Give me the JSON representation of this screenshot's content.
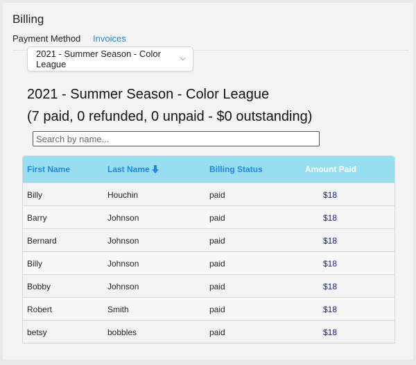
{
  "page": {
    "title": "Billing"
  },
  "tabs": [
    {
      "label": "Payment Method",
      "active": false
    },
    {
      "label": "Invoices",
      "active": true
    }
  ],
  "season_select": {
    "value": "2021 - Summer Season - Color League"
  },
  "heading": {
    "season": "2021 - Summer Season - Color League",
    "summary": "(7 paid, 0 refunded, 0 unpaid - $0 outstanding)"
  },
  "search": {
    "placeholder": "Search by name...",
    "value": ""
  },
  "table": {
    "columns": [
      "First Name",
      "Last Name",
      "Billing Status",
      "Amount Paid"
    ],
    "sorted_by": "Last Name",
    "rows": [
      {
        "first": "Billy",
        "last": "Houchin",
        "status": "paid",
        "amount": "$18"
      },
      {
        "first": "Barry",
        "last": "Johnson",
        "status": "paid",
        "amount": "$18"
      },
      {
        "first": "Bernard",
        "last": "Johnson",
        "status": "paid",
        "amount": "$18"
      },
      {
        "first": "Billy",
        "last": "Johnson",
        "status": "paid",
        "amount": "$18"
      },
      {
        "first": "Bobby",
        "last": "Johnson",
        "status": "paid",
        "amount": "$18"
      },
      {
        "first": "Robert",
        "last": "Smith",
        "status": "paid",
        "amount": "$18"
      },
      {
        "first": "betsy",
        "last": "bobbles",
        "status": "paid",
        "amount": "$18"
      }
    ]
  },
  "colors": {
    "accent": "#1e88e5",
    "header_bg": "#96def0",
    "amount": "#1a237e"
  }
}
